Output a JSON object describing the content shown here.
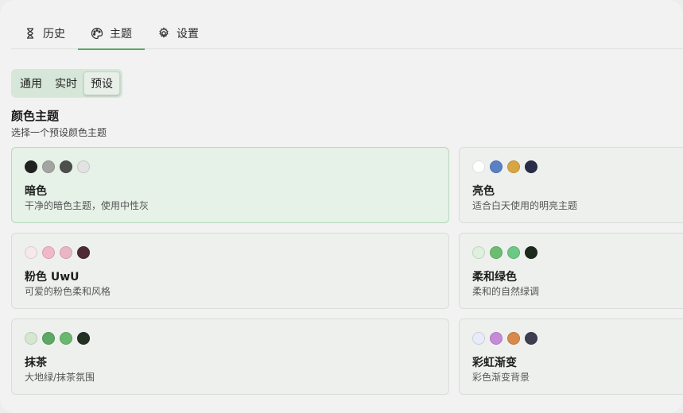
{
  "tabs": [
    {
      "label": "历史",
      "icon": "hourglass-icon"
    },
    {
      "label": "主题",
      "icon": "palette-icon"
    },
    {
      "label": "设置",
      "icon": "gear-icon"
    }
  ],
  "segmented": [
    {
      "label": "通用"
    },
    {
      "label": "实时"
    },
    {
      "label": "预设"
    }
  ],
  "section": {
    "title": "颜色主题",
    "subtitle": "选择一个预设颜色主题"
  },
  "themes": [
    {
      "name": "暗色",
      "desc": "干净的暗色主题，使用中性灰",
      "colors": [
        "#1f2220",
        "#a3a5a3",
        "#4c4f4c",
        "#e2e3e2"
      ],
      "selected": true
    },
    {
      "name": "亮色",
      "desc": "适合白天使用的明亮主题",
      "colors": [
        "#ffffff",
        "#5a80c6",
        "#d9a442",
        "#2a2d48"
      ],
      "selected": false
    },
    {
      "name": "粉色 UwU",
      "desc": "可爱的粉色柔和风格",
      "colors": [
        "#f6e9ee",
        "#f0b8c8",
        "#eab6c6",
        "#4e2a34"
      ],
      "selected": false
    },
    {
      "name": "柔和绿色",
      "desc": "柔和的自然绿调",
      "colors": [
        "#dff0df",
        "#6cbd71",
        "#6cc985",
        "#1c2a1c"
      ],
      "selected": false
    },
    {
      "name": "抹茶",
      "desc": "大地绿/抹茶氛围",
      "colors": [
        "#d5e6d1",
        "#5da864",
        "#6ab86f",
        "#233024"
      ],
      "selected": false
    },
    {
      "name": "彩虹渐变",
      "desc": "彩色渐变背景",
      "colors": [
        "#e8ebf8",
        "#c68bd6",
        "#d9894a",
        "#3d3e52"
      ],
      "selected": false
    }
  ],
  "accent": "#5aa869"
}
